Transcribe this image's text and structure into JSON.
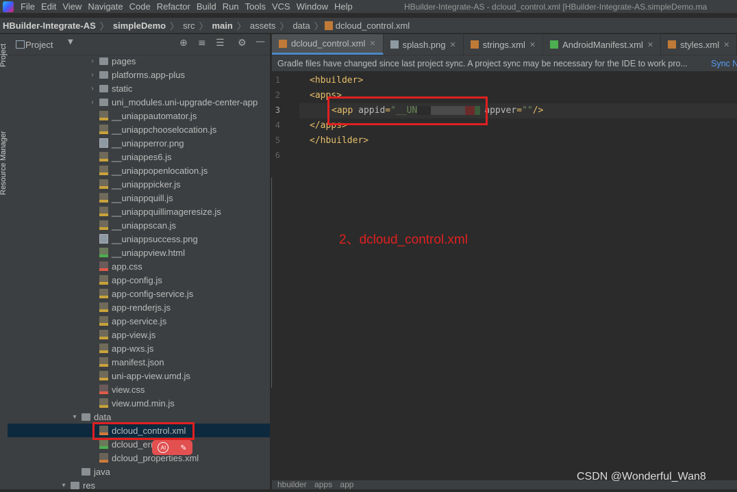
{
  "menubar": {
    "items": [
      "File",
      "Edit",
      "View",
      "Navigate",
      "Code",
      "Refactor",
      "Build",
      "Run",
      "Tools",
      "VCS",
      "Window",
      "Help"
    ],
    "window_title": "HBuilder-Integrate-AS - dcloud_control.xml [HBuilder-Integrate-AS.simpleDemo.ma"
  },
  "breadcrumb": {
    "items": [
      "HBuilder-Integrate-AS",
      "simpleDemo",
      "src",
      "main",
      "assets",
      "data",
      "dcloud_control.xml"
    ]
  },
  "sidebar": {
    "project_label": "Project",
    "resource_manager_label": "Resource Manager"
  },
  "tree": {
    "rows": [
      {
        "label": "pages",
        "type": "folder"
      },
      {
        "label": "platforms.app-plus",
        "type": "folder"
      },
      {
        "label": "static",
        "type": "folder"
      },
      {
        "label": "uni_modules.uni-upgrade-center-app",
        "type": "folder"
      },
      {
        "label": "__uniappautomator.js",
        "type": "js"
      },
      {
        "label": "__uniappchooselocation.js",
        "type": "js"
      },
      {
        "label": "__uniapperror.png",
        "type": "png"
      },
      {
        "label": "__uniappes6.js",
        "type": "js"
      },
      {
        "label": "__uniappopenlocation.js",
        "type": "js"
      },
      {
        "label": "__uniapppicker.js",
        "type": "js"
      },
      {
        "label": "__uniappquill.js",
        "type": "js"
      },
      {
        "label": "__uniappquillimageresize.js",
        "type": "js"
      },
      {
        "label": "__uniappscan.js",
        "type": "js"
      },
      {
        "label": "__uniappsuccess.png",
        "type": "png"
      },
      {
        "label": "__uniappview.html",
        "type": "html"
      },
      {
        "label": "app.css",
        "type": "css"
      },
      {
        "label": "app-config.js",
        "type": "js"
      },
      {
        "label": "app-config-service.js",
        "type": "js"
      },
      {
        "label": "app-renderjs.js",
        "type": "js"
      },
      {
        "label": "app-service.js",
        "type": "js"
      },
      {
        "label": "app-view.js",
        "type": "js"
      },
      {
        "label": "app-wxs.js",
        "type": "js"
      },
      {
        "label": "manifest.json",
        "type": "json"
      },
      {
        "label": "uni-app-view.umd.js",
        "type": "js"
      },
      {
        "label": "view.css",
        "type": "css"
      },
      {
        "label": "view.umd.min.js",
        "type": "js"
      },
      {
        "label": "data",
        "type": "folder"
      },
      {
        "label": "dcloud_control.xml",
        "type": "xml"
      },
      {
        "label": "dcloud_err",
        "type": "html"
      },
      {
        "label": "dcloud_properties.xml",
        "type": "xml"
      },
      {
        "label": "java",
        "type": "folder"
      },
      {
        "label": "res",
        "type": "folder"
      }
    ]
  },
  "tabs": [
    {
      "label": "dcloud_control.xml"
    },
    {
      "label": "splash.png"
    },
    {
      "label": "strings.xml"
    },
    {
      "label": "AndroidManifest.xml"
    },
    {
      "label": "styles.xml"
    }
  ],
  "banner": {
    "message": "Gradle files have changed since last project sync. A project sync may be necessary for the IDE to work pro...",
    "link": "Sync N"
  },
  "code": {
    "line_numbers": [
      "1",
      "2",
      "3",
      "4",
      "5",
      "6"
    ],
    "l1": "<hbuilder>",
    "l2": "<apps>",
    "l3_tag": "<app ",
    "l3_attr1": "appid",
    "l3_eq1": "=",
    "l3_val1": "\"__UN",
    "l3_attr2": "appver",
    "l3_eq2": "=",
    "l3_val2": "\"\"",
    "l3_end": "/>",
    "l4": "</apps>",
    "l5": "</hbuilder>"
  },
  "annotation": "2、dcloud_control.xml",
  "statusbar": {
    "items": [
      "hbuilder",
      "apps",
      "app"
    ]
  },
  "watermark": "CSDN @Wonderful_Wan8",
  "float": {
    "ai": "AI"
  }
}
